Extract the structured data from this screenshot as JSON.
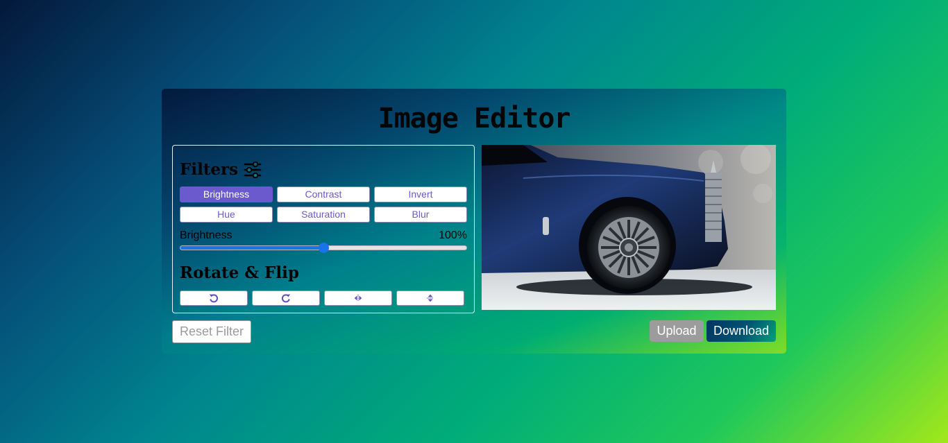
{
  "app": {
    "title": "Image Editor"
  },
  "filters": {
    "heading": "Filters",
    "heading_icon": "sliders-icon",
    "options": [
      {
        "label": "Brightness",
        "active": true
      },
      {
        "label": "Contrast",
        "active": false
      },
      {
        "label": "Invert",
        "active": false
      },
      {
        "label": "Hue",
        "active": false
      },
      {
        "label": "Saturation",
        "active": false
      },
      {
        "label": "Blur",
        "active": false
      }
    ],
    "active_color": "#6a5acd"
  },
  "slider": {
    "name": "Brightness",
    "value": "100%",
    "level": 0.5
  },
  "rotate": {
    "heading": "Rotate & Flip",
    "buttons": [
      {
        "icon": "rotate-left-icon"
      },
      {
        "icon": "rotate-right-icon"
      },
      {
        "icon": "flip-horizontal-icon"
      },
      {
        "icon": "flip-vertical-icon"
      }
    ]
  },
  "actions": {
    "reset_label": "Reset Filter",
    "upload_label": "Upload",
    "download_label": "Download"
  }
}
